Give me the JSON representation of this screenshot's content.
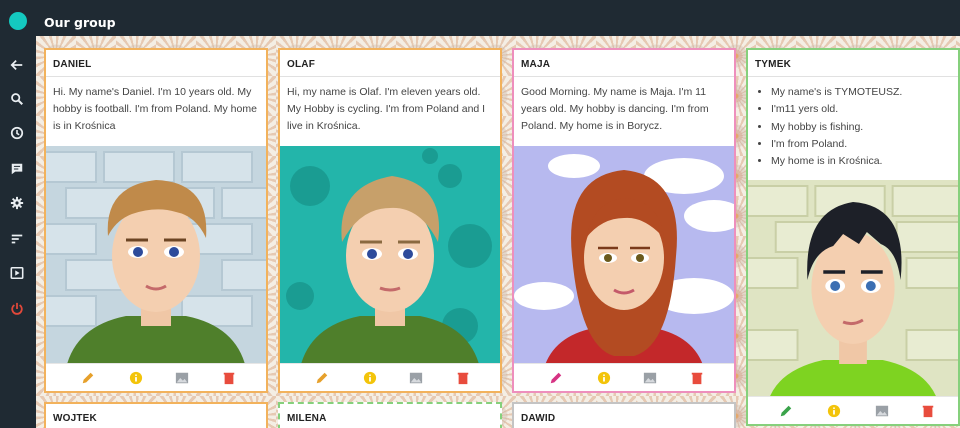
{
  "app": {
    "title": "Our group"
  },
  "sidebar": {
    "items": [
      {
        "icon": "back-arrow-icon"
      },
      {
        "icon": "search-icon"
      },
      {
        "icon": "clock-icon"
      },
      {
        "icon": "comment-icon"
      },
      {
        "icon": "gear-icon"
      },
      {
        "icon": "sort-icon"
      },
      {
        "icon": "slideshow-icon"
      },
      {
        "icon": "power-icon"
      }
    ]
  },
  "colors": {
    "topbar": "#1f2a33",
    "accent": "#14c9c0",
    "edit": "#e6a02b",
    "info": "#f3c40a",
    "image": "#9aa0a6",
    "delete": "#e84c3d",
    "power": "#e2483a"
  },
  "cards": [
    {
      "name": "DANIEL",
      "text": "Hi. My name's Daniel. I'm 10 years old. My hobby is football. I'm from Poland. My home is in Krośnica",
      "border": "#f2b25c"
    },
    {
      "name": "OLAF",
      "text": "Hi, my name is Olaf. I'm eleven years old. My Hobby is cycling. I'm from Poland and I live in Krośnica.",
      "border": "#f2b25c"
    },
    {
      "name": "MAJA",
      "text": "Good Morning. My name is Maja. I'm 11 years old. My hobby is dancing. I'm from Poland. My home is in Borycz.",
      "border": "#ee8fbd"
    },
    {
      "name": "TYMEK",
      "items": [
        "My name's is TYMOTEUSZ.",
        "I'm11 yers old.",
        "My hobby is fishing.",
        "I'm from Poland.",
        "My home is in Krośnica."
      ],
      "border": "#86d07c"
    },
    {
      "name": "WOJTEK",
      "border": "#f2b25c"
    },
    {
      "name": "MILENA",
      "border": "#86d07c"
    },
    {
      "name": "DAWID",
      "border": "#c4c4c4"
    }
  ]
}
